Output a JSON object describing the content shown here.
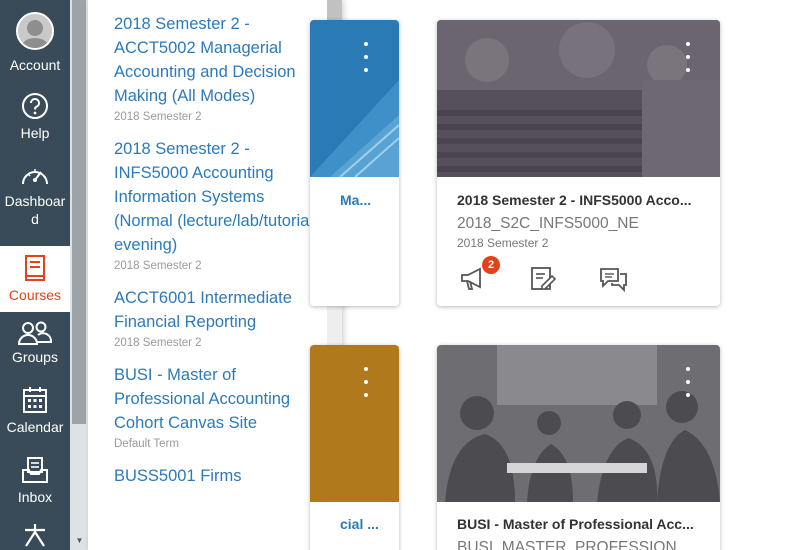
{
  "global_nav": {
    "items": [
      {
        "label": "Account"
      },
      {
        "label": "Help"
      },
      {
        "label": "Dashboar\nd"
      },
      {
        "label": "Courses"
      },
      {
        "label": "Groups"
      },
      {
        "label": "Calendar"
      },
      {
        "label": "Inbox"
      }
    ]
  },
  "courses_tray": {
    "items": [
      {
        "title": "2018 Semester 2 - ACCT5002 Managerial Accounting and Decision Making (All Modes)",
        "term": "2018 Semester 2"
      },
      {
        "title": "2018 Semester 2 - INFS5000 Accounting Information Systems (Normal (lecture/lab/tutorial) evening)",
        "term": "2018 Semester 2"
      },
      {
        "title": "ACCT6001 Intermediate Financial Reporting",
        "term": "2018 Semester 2"
      },
      {
        "title": "BUSI - Master of Professional Accounting Cohort Canvas Site",
        "term": "Default Term"
      },
      {
        "title": "BUSS5001 Firms",
        "term": ""
      }
    ]
  },
  "cards": [
    {
      "partial_title": "Ma...",
      "hero_color": "#2a7ab5"
    },
    {
      "title": "2018 Semester 2 - INFS5000 Acco...",
      "code": "2018_S2C_INFS5000_NE",
      "term": "2018 Semester 2",
      "announcement_badge": "2"
    },
    {
      "partial_title": "cial ...",
      "hero_color": "#b07a1c"
    },
    {
      "title": "BUSI - Master of Professional Acc...",
      "code": "BUSI_MASTER_PROFESSION"
    }
  ],
  "colors": {
    "nav_bg": "#394b58",
    "accent": "#e0441b",
    "link": "#2b7abc"
  }
}
